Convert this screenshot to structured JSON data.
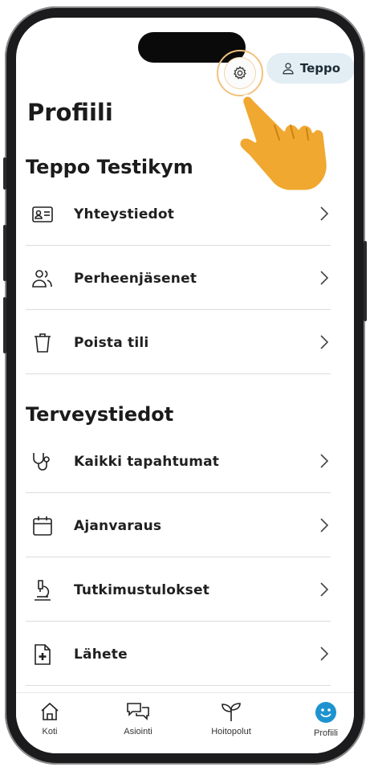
{
  "header": {
    "settings_icon": "gear-icon",
    "user_chip_label": "Teppo",
    "user_icon": "person-icon"
  },
  "page_title": "Profiili",
  "sections": [
    {
      "title": "Teppo Testikym",
      "items": [
        {
          "label": "Yhteystiedot",
          "icon": "contact-card-icon"
        },
        {
          "label": "Perheenjäsenet",
          "icon": "family-icon"
        },
        {
          "label": "Poista tili",
          "icon": "trash-icon"
        }
      ]
    },
    {
      "title": "Terveystiedot",
      "items": [
        {
          "label": "Kaikki tapahtumat",
          "icon": "stethoscope-icon"
        },
        {
          "label": "Ajanvaraus",
          "icon": "calendar-icon"
        },
        {
          "label": "Tutkimustulokset",
          "icon": "microscope-icon"
        },
        {
          "label": "Lähete",
          "icon": "document-plus-icon"
        }
      ]
    }
  ],
  "tabs": [
    {
      "label": "Koti",
      "icon": "home-icon"
    },
    {
      "label": "Asiointi",
      "icon": "chat-icon"
    },
    {
      "label": "Hoitopolut",
      "icon": "sprout-icon"
    },
    {
      "label": "Profiili",
      "icon": "smiley-icon",
      "active": true
    }
  ],
  "colors": {
    "accent": "#1e93cf",
    "chip_bg": "#e3edf4",
    "hand": "#f0a830",
    "highlight_ring": "#f1c27d"
  }
}
